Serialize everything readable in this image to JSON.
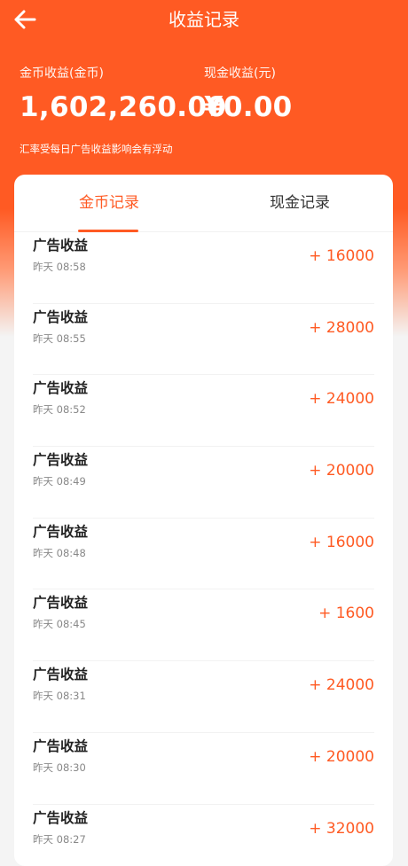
{
  "header": {
    "title": "收益记录",
    "back_icon": "arrow-left-icon"
  },
  "stats": {
    "gold_label": "金币收益(金币)",
    "gold_value": "1,602,260.00",
    "cash_label": "现金收益(元)",
    "cash_value": "¥0.00"
  },
  "notice": "汇率受每日广告收益影响会有浮动",
  "tabs": [
    {
      "label": "金币记录",
      "active": true
    },
    {
      "label": "现金记录",
      "active": false
    }
  ],
  "records": [
    {
      "title": "广告收益",
      "time": "昨天 08:58",
      "amount": "+ 16000"
    },
    {
      "title": "广告收益",
      "time": "昨天 08:55",
      "amount": "+ 28000"
    },
    {
      "title": "广告收益",
      "time": "昨天 08:52",
      "amount": "+ 24000"
    },
    {
      "title": "广告收益",
      "time": "昨天 08:49",
      "amount": "+ 20000"
    },
    {
      "title": "广告收益",
      "time": "昨天 08:48",
      "amount": "+ 16000"
    },
    {
      "title": "广告收益",
      "time": "昨天 08:45",
      "amount": "+ 1600"
    },
    {
      "title": "广告收益",
      "time": "昨天 08:31",
      "amount": "+ 24000"
    },
    {
      "title": "广告收益",
      "time": "昨天 08:30",
      "amount": "+ 20000"
    },
    {
      "title": "广告收益",
      "time": "昨天 08:27",
      "amount": "+ 32000"
    }
  ],
  "colors": {
    "accent": "#ff5a23",
    "text_dark": "#222222",
    "text_muted": "#888888"
  }
}
